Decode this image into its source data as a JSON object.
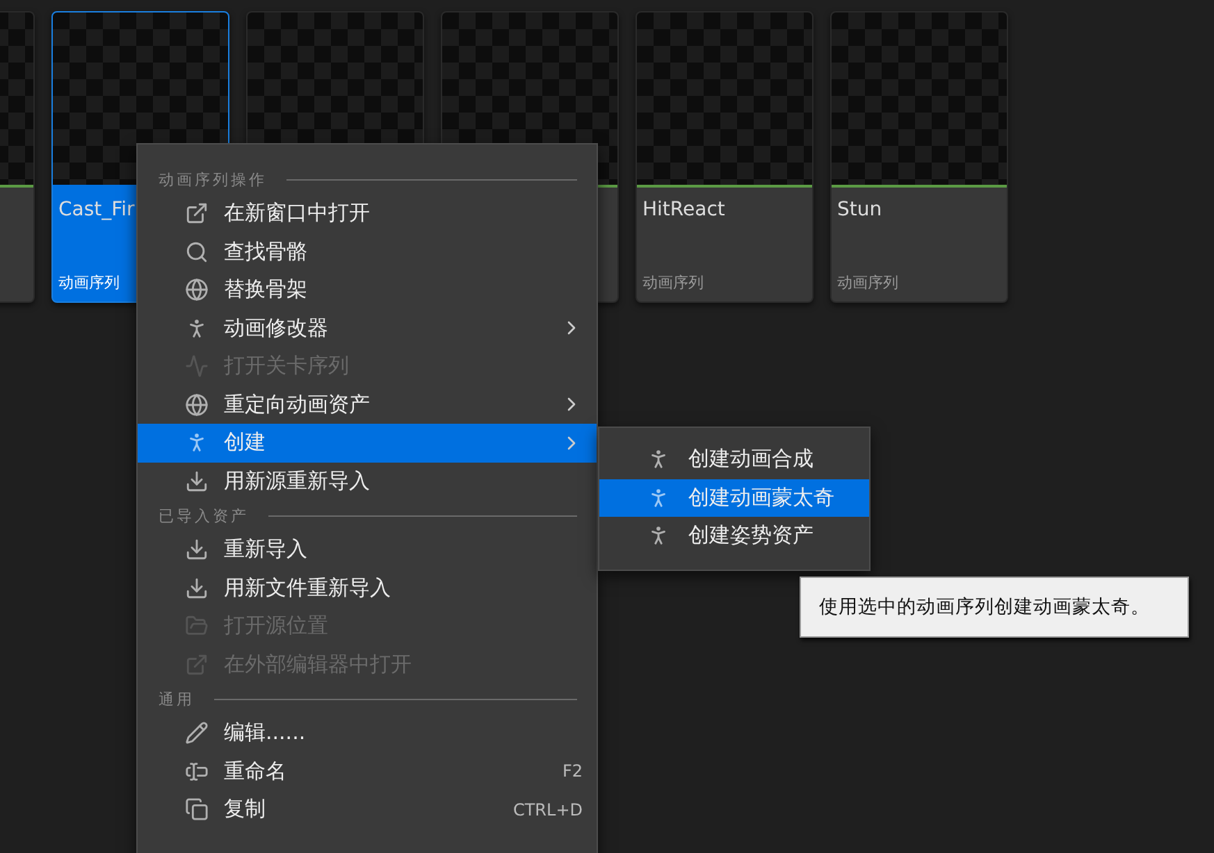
{
  "assets": [
    {
      "selected": false
    },
    {
      "name": "Cast_Fir",
      "type_label": "动画序列",
      "selected": true
    },
    {
      "selected": false
    },
    {
      "selected": false
    },
    {
      "name": "HitReact",
      "type_label": "动画序列",
      "selected": false
    },
    {
      "name": "Stun",
      "type_label": "动画序列",
      "selected": false
    }
  ],
  "context_menu": {
    "sections": [
      {
        "title": "动画序列操作",
        "items": [
          {
            "label": "在新窗口中打开",
            "disabled": false,
            "submenu": false,
            "selected": false
          },
          {
            "label": "查找骨骼",
            "disabled": false,
            "submenu": false,
            "selected": false
          },
          {
            "label": "替换骨架",
            "disabled": false,
            "submenu": false,
            "selected": false
          },
          {
            "label": "动画修改器",
            "disabled": false,
            "submenu": true,
            "selected": false
          },
          {
            "label": "打开关卡序列",
            "disabled": true,
            "submenu": false,
            "selected": false
          },
          {
            "label": "重定向动画资产",
            "disabled": false,
            "submenu": true,
            "selected": false
          },
          {
            "label": "创建",
            "disabled": false,
            "submenu": true,
            "selected": true
          },
          {
            "label": "用新源重新导入",
            "disabled": false,
            "submenu": false,
            "selected": false
          }
        ]
      },
      {
        "title": "已导入资产",
        "items": [
          {
            "label": "重新导入",
            "disabled": false,
            "submenu": false,
            "selected": false
          },
          {
            "label": "用新文件重新导入",
            "disabled": false,
            "submenu": false,
            "selected": false
          },
          {
            "label": "打开源位置",
            "disabled": true,
            "submenu": false,
            "selected": false
          },
          {
            "label": "在外部编辑器中打开",
            "disabled": true,
            "submenu": false,
            "selected": false
          }
        ]
      },
      {
        "title": "通用",
        "items": [
          {
            "label": "编辑......",
            "disabled": false,
            "submenu": false,
            "selected": false
          },
          {
            "label": "重命名",
            "shortcut": "F2",
            "disabled": false,
            "submenu": false,
            "selected": false
          },
          {
            "label": "复制",
            "shortcut": "CTRL+D",
            "disabled": false,
            "submenu": false,
            "selected": false
          }
        ]
      }
    ]
  },
  "submenu": {
    "items": [
      {
        "label": "创建动画合成",
        "selected": false
      },
      {
        "label": "创建动画蒙太奇",
        "selected": true
      },
      {
        "label": "创建姿势资产",
        "selected": false
      }
    ]
  },
  "tooltip": {
    "text": "使用选中的动画序列创建动画蒙太奇。"
  }
}
